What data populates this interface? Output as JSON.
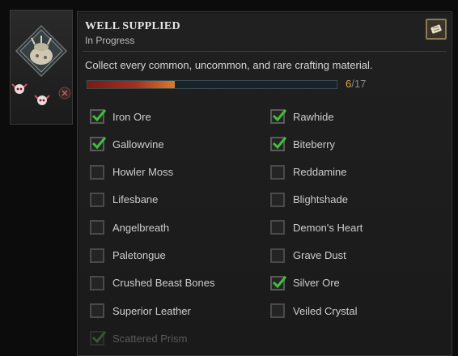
{
  "achievement": {
    "title": "WELL SUPPLIED",
    "status": "In Progress",
    "description": "Collect every common, uncommon, and rare crafting material.",
    "progress_current": "6",
    "progress_total": "/17",
    "progress_fraction": 0.35
  },
  "colors": {
    "check": "#3fbf3a",
    "progress_accent": "#e2a84a"
  },
  "materials": {
    "left": [
      {
        "label": "Iron Ore",
        "checked": true
      },
      {
        "label": "Gallowvine",
        "checked": true
      },
      {
        "label": "Howler Moss",
        "checked": false
      },
      {
        "label": "Lifesbane",
        "checked": false
      },
      {
        "label": "Angelbreath",
        "checked": false
      },
      {
        "label": "Paletongue",
        "checked": false
      },
      {
        "label": "Crushed Beast Bones",
        "checked": false
      },
      {
        "label": "Superior Leather",
        "checked": false
      },
      {
        "label": "Scattered Prism",
        "checked": true
      }
    ],
    "right": [
      {
        "label": "Rawhide",
        "checked": true
      },
      {
        "label": "Biteberry",
        "checked": true
      },
      {
        "label": "Reddamine",
        "checked": false
      },
      {
        "label": "Blightshade",
        "checked": false
      },
      {
        "label": "Demon's Heart",
        "checked": false
      },
      {
        "label": "Grave Dust",
        "checked": false
      },
      {
        "label": "Silver Ore",
        "checked": true
      },
      {
        "label": "Veiled Crystal",
        "checked": false
      }
    ]
  }
}
